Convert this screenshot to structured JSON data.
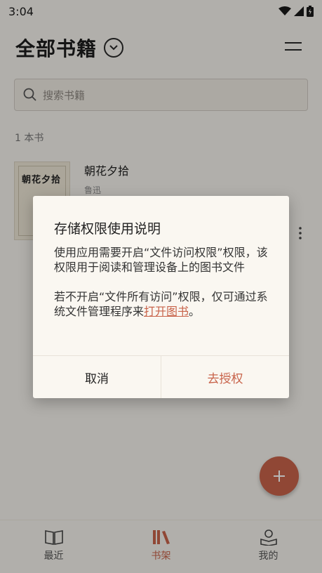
{
  "status": {
    "time": "3:04"
  },
  "header": {
    "title": "全部书籍"
  },
  "search": {
    "placeholder": "搜索书籍"
  },
  "library": {
    "count": "1 本书",
    "books": [
      {
        "title": "朝花夕拾",
        "author": "鲁迅",
        "cover_text": "朝花夕拾"
      }
    ]
  },
  "nav": {
    "items": [
      {
        "label": "最近",
        "icon": "book-open-icon"
      },
      {
        "label": "书架",
        "icon": "bookshelf-icon",
        "active": true
      },
      {
        "label": "我的",
        "icon": "reader-profile-icon"
      }
    ]
  },
  "dialog": {
    "title": "存储权限使用说明",
    "para1": "使用应用需要开启“文件访问权限”权限，该权限用于阅读和管理设备上的图书文件",
    "para2_prefix": "若不开启“文件所有访问”权限，仅可通过系统文件管理程序来",
    "para2_link": "打开图书",
    "para2_suffix": "。",
    "cancel_label": "取消",
    "confirm_label": "去授权"
  },
  "colors": {
    "accent": "#c8634a",
    "background": "#f6f3ed"
  }
}
